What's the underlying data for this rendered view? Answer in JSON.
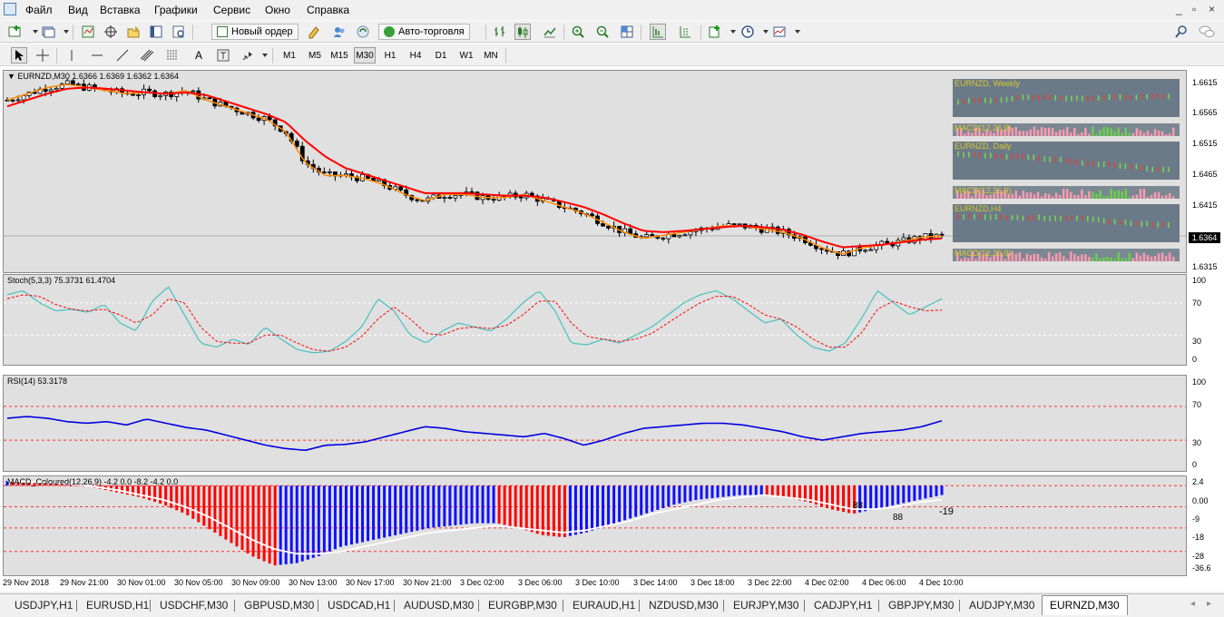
{
  "menu": [
    "Файл",
    "Вид",
    "Вставка",
    "Графики",
    "Сервис",
    "Окно",
    "Справка"
  ],
  "window_controls": [
    "_",
    "▫",
    "×"
  ],
  "toolbar1": {
    "new_order": "Новый ордер",
    "auto_trading": "Авто-торговля"
  },
  "toolbar2": {
    "text_tool": "A",
    "timeframes": [
      "M1",
      "M5",
      "M15",
      "M30",
      "H1",
      "H4",
      "D1",
      "W1",
      "MN"
    ],
    "active_timeframe": "M30"
  },
  "main_chart": {
    "title": "▼ EURNZD,M30  1.6366 1.6369 1.6362 1.6364",
    "price_labels": [
      "1.6615",
      "1.6565",
      "1.6515",
      "1.6465",
      "1.6415",
      "1.6315"
    ],
    "current_price": "1.6364",
    "mtf_panels": [
      {
        "label": "EURNZD, Weekly"
      },
      {
        "label": "MACD(12,26,9)"
      },
      {
        "label": "EURNZD, Daily"
      },
      {
        "label": "MACD(12,26,9)"
      },
      {
        "label": "EURNZD,H4"
      },
      {
        "label": "MACD(12,26,9)"
      }
    ]
  },
  "stoch": {
    "title": "Stoch(5,3,3) 75.3731 61.4704",
    "levels": [
      "100",
      "70",
      "30",
      "0"
    ]
  },
  "rsi": {
    "title": "RSI(14) 53.3178",
    "levels": [
      "100",
      "70",
      "30",
      "0"
    ]
  },
  "macd": {
    "title": "MACD_Coloured(12,26,9) -4.2 0.0 -8.2 -4.2 0.0",
    "levels": [
      "2.4",
      "0.00",
      "-9",
      "-18",
      "-28",
      "-36.6"
    ],
    "value_label": "-19",
    "inline_labels": [
      "88",
      "88"
    ]
  },
  "time_axis": [
    "29 Nov 2018",
    "29 Nov 21:00",
    "30 Nov 01:00",
    "30 Nov 05:00",
    "30 Nov 09:00",
    "30 Nov 13:00",
    "30 Nov 17:00",
    "30 Nov 21:00",
    "3 Dec 02:00",
    "3 Dec 06:00",
    "3 Dec 10:00",
    "3 Dec 14:00",
    "3 Dec 18:00",
    "3 Dec 22:00",
    "4 Dec 02:00",
    "4 Dec 06:00",
    "4 Dec 10:00"
  ],
  "tabs": [
    "USDJPY,H1",
    "EURUSD,H1",
    "USDCHF,M30",
    "GBPUSD,M30",
    "USDCAD,H1",
    "AUDUSD,M30",
    "EURGBP,M30",
    "EURAUD,H1",
    "NZDUSD,M30",
    "EURJPY,M30",
    "CADJPY,H1",
    "GBPJPY,M30",
    "AUDJPY,M30",
    "EURNZD,M30"
  ],
  "active_tab": "EURNZD,M30",
  "colors": {
    "chart_bg": "#e0e0e0",
    "ma_fast": "#ff8c00",
    "ma_slow": "#ff0000",
    "stoch_main": "#48c0c0",
    "stoch_signal": "#ff0000",
    "rsi_line": "#0000e0",
    "macd_up": "#1010ff",
    "macd_down": "#ff0000",
    "macd_signal": "#ffffff"
  },
  "chart_data": [
    {
      "type": "line",
      "title": "EURNZD,M30",
      "series": [
        {
          "values": [
            1.658,
            1.659,
            1.66,
            1.6605,
            1.66,
            1.6595,
            1.659,
            1.6592,
            1.659,
            1.6595,
            1.658,
            1.657,
            1.656,
            1.655,
            1.653,
            1.648,
            1.646,
            1.646,
            1.6455,
            1.6445,
            1.643,
            1.642,
            1.643,
            1.643,
            1.6425,
            1.6425,
            1.643,
            1.642,
            1.641,
            1.64,
            1.6385,
            1.637,
            1.636,
            1.6365,
            1.637,
            1.6375,
            1.638,
            1.638,
            1.6375,
            1.637,
            1.636,
            1.6345,
            1.6335,
            1.6345,
            1.635,
            1.6355,
            1.6362,
            1.6364
          ]
        },
        {
          "values": [
            1.657,
            1.658,
            1.659,
            1.6598,
            1.66,
            1.6598,
            1.6595,
            1.6592,
            1.659,
            1.6592,
            1.6588,
            1.6578,
            1.6568,
            1.6558,
            1.6545,
            1.6515,
            1.649,
            1.6472,
            1.6462,
            1.6452,
            1.6442,
            1.6432,
            1.6432,
            1.6432,
            1.643,
            1.6428,
            1.6428,
            1.6425,
            1.6418,
            1.641,
            1.6398,
            1.6384,
            1.6372,
            1.637,
            1.6372,
            1.6375,
            1.6378,
            1.638,
            1.6378,
            1.6374,
            1.6366,
            1.6355,
            1.6346,
            1.6348,
            1.635,
            1.6354,
            1.6358,
            1.636
          ]
        }
      ],
      "ylim": [
        1.6315,
        1.6615
      ]
    },
    {
      "type": "line",
      "title": "Stoch(5,3,3) 75.3731 61.4704",
      "series": [
        {
          "values": [
            80,
            85,
            70,
            60,
            62,
            58,
            68,
            45,
            35,
            72,
            90,
            55,
            20,
            15,
            25,
            18,
            40,
            25,
            12,
            8,
            10,
            22,
            40,
            75,
            60,
            30,
            20,
            35,
            45,
            40,
            35,
            50,
            70,
            85,
            60,
            20,
            18,
            25,
            20,
            30,
            40,
            55,
            70,
            80,
            85,
            75,
            60,
            45,
            50,
            30,
            15,
            10,
            20,
            50,
            85,
            70,
            55,
            65,
            75
          ]
        },
        {
          "values": [
            75,
            80,
            78,
            68,
            62,
            60,
            62,
            55,
            45,
            55,
            75,
            70,
            40,
            22,
            20,
            20,
            30,
            30,
            20,
            12,
            10,
            15,
            28,
            50,
            65,
            50,
            32,
            30,
            38,
            40,
            38,
            42,
            55,
            72,
            72,
            45,
            28,
            25,
            22,
            25,
            32,
            45,
            58,
            70,
            78,
            78,
            68,
            55,
            50,
            40,
            25,
            15,
            15,
            32,
            62,
            72,
            65,
            60,
            61
          ]
        }
      ],
      "ylim": [
        0,
        100
      ]
    },
    {
      "type": "line",
      "title": "RSI(14) 53.3178",
      "series": [
        {
          "values": [
            56,
            58,
            56,
            52,
            50,
            52,
            48,
            55,
            50,
            45,
            42,
            36,
            30,
            24,
            20,
            18,
            24,
            25,
            28,
            34,
            40,
            46,
            44,
            40,
            38,
            36,
            34,
            38,
            32,
            24,
            30,
            38,
            44,
            46,
            48,
            50,
            50,
            48,
            44,
            40,
            34,
            30,
            34,
            38,
            40,
            42,
            46,
            53
          ]
        }
      ],
      "ylim": [
        0,
        100
      ]
    },
    {
      "type": "bar",
      "title": "MACD_Coloured(12,26,9) -4.2 0.0 -8.2 -4.2 0.0",
      "values": [
        2.0,
        1.8,
        1.2,
        0.4,
        -1,
        -3,
        -5,
        -8,
        -12,
        -18,
        -24,
        -30,
        -34,
        -33,
        -30,
        -26,
        -24,
        -22,
        -20,
        -18,
        -17,
        -16,
        -16,
        -18,
        -21,
        -22,
        -20,
        -17,
        -14,
        -11,
        -8,
        -6,
        -5,
        -4,
        -4,
        -5,
        -7,
        -10,
        -12,
        -10,
        -8,
        -6,
        -4
      ],
      "signal": [
        2.0,
        1.6,
        1.2,
        0.5,
        -0.5,
        -2,
        -4,
        -6,
        -9,
        -13,
        -18,
        -23,
        -27,
        -29,
        -29,
        -28,
        -26,
        -24,
        -22,
        -20,
        -19,
        -18,
        -17,
        -18,
        -19,
        -20,
        -19,
        -17,
        -15,
        -12,
        -10,
        -8,
        -6,
        -5,
        -4,
        -5,
        -6,
        -8,
        -10,
        -10,
        -9,
        -7,
        -6
      ],
      "ylim": [
        -36.6,
        2.4
      ]
    }
  ]
}
